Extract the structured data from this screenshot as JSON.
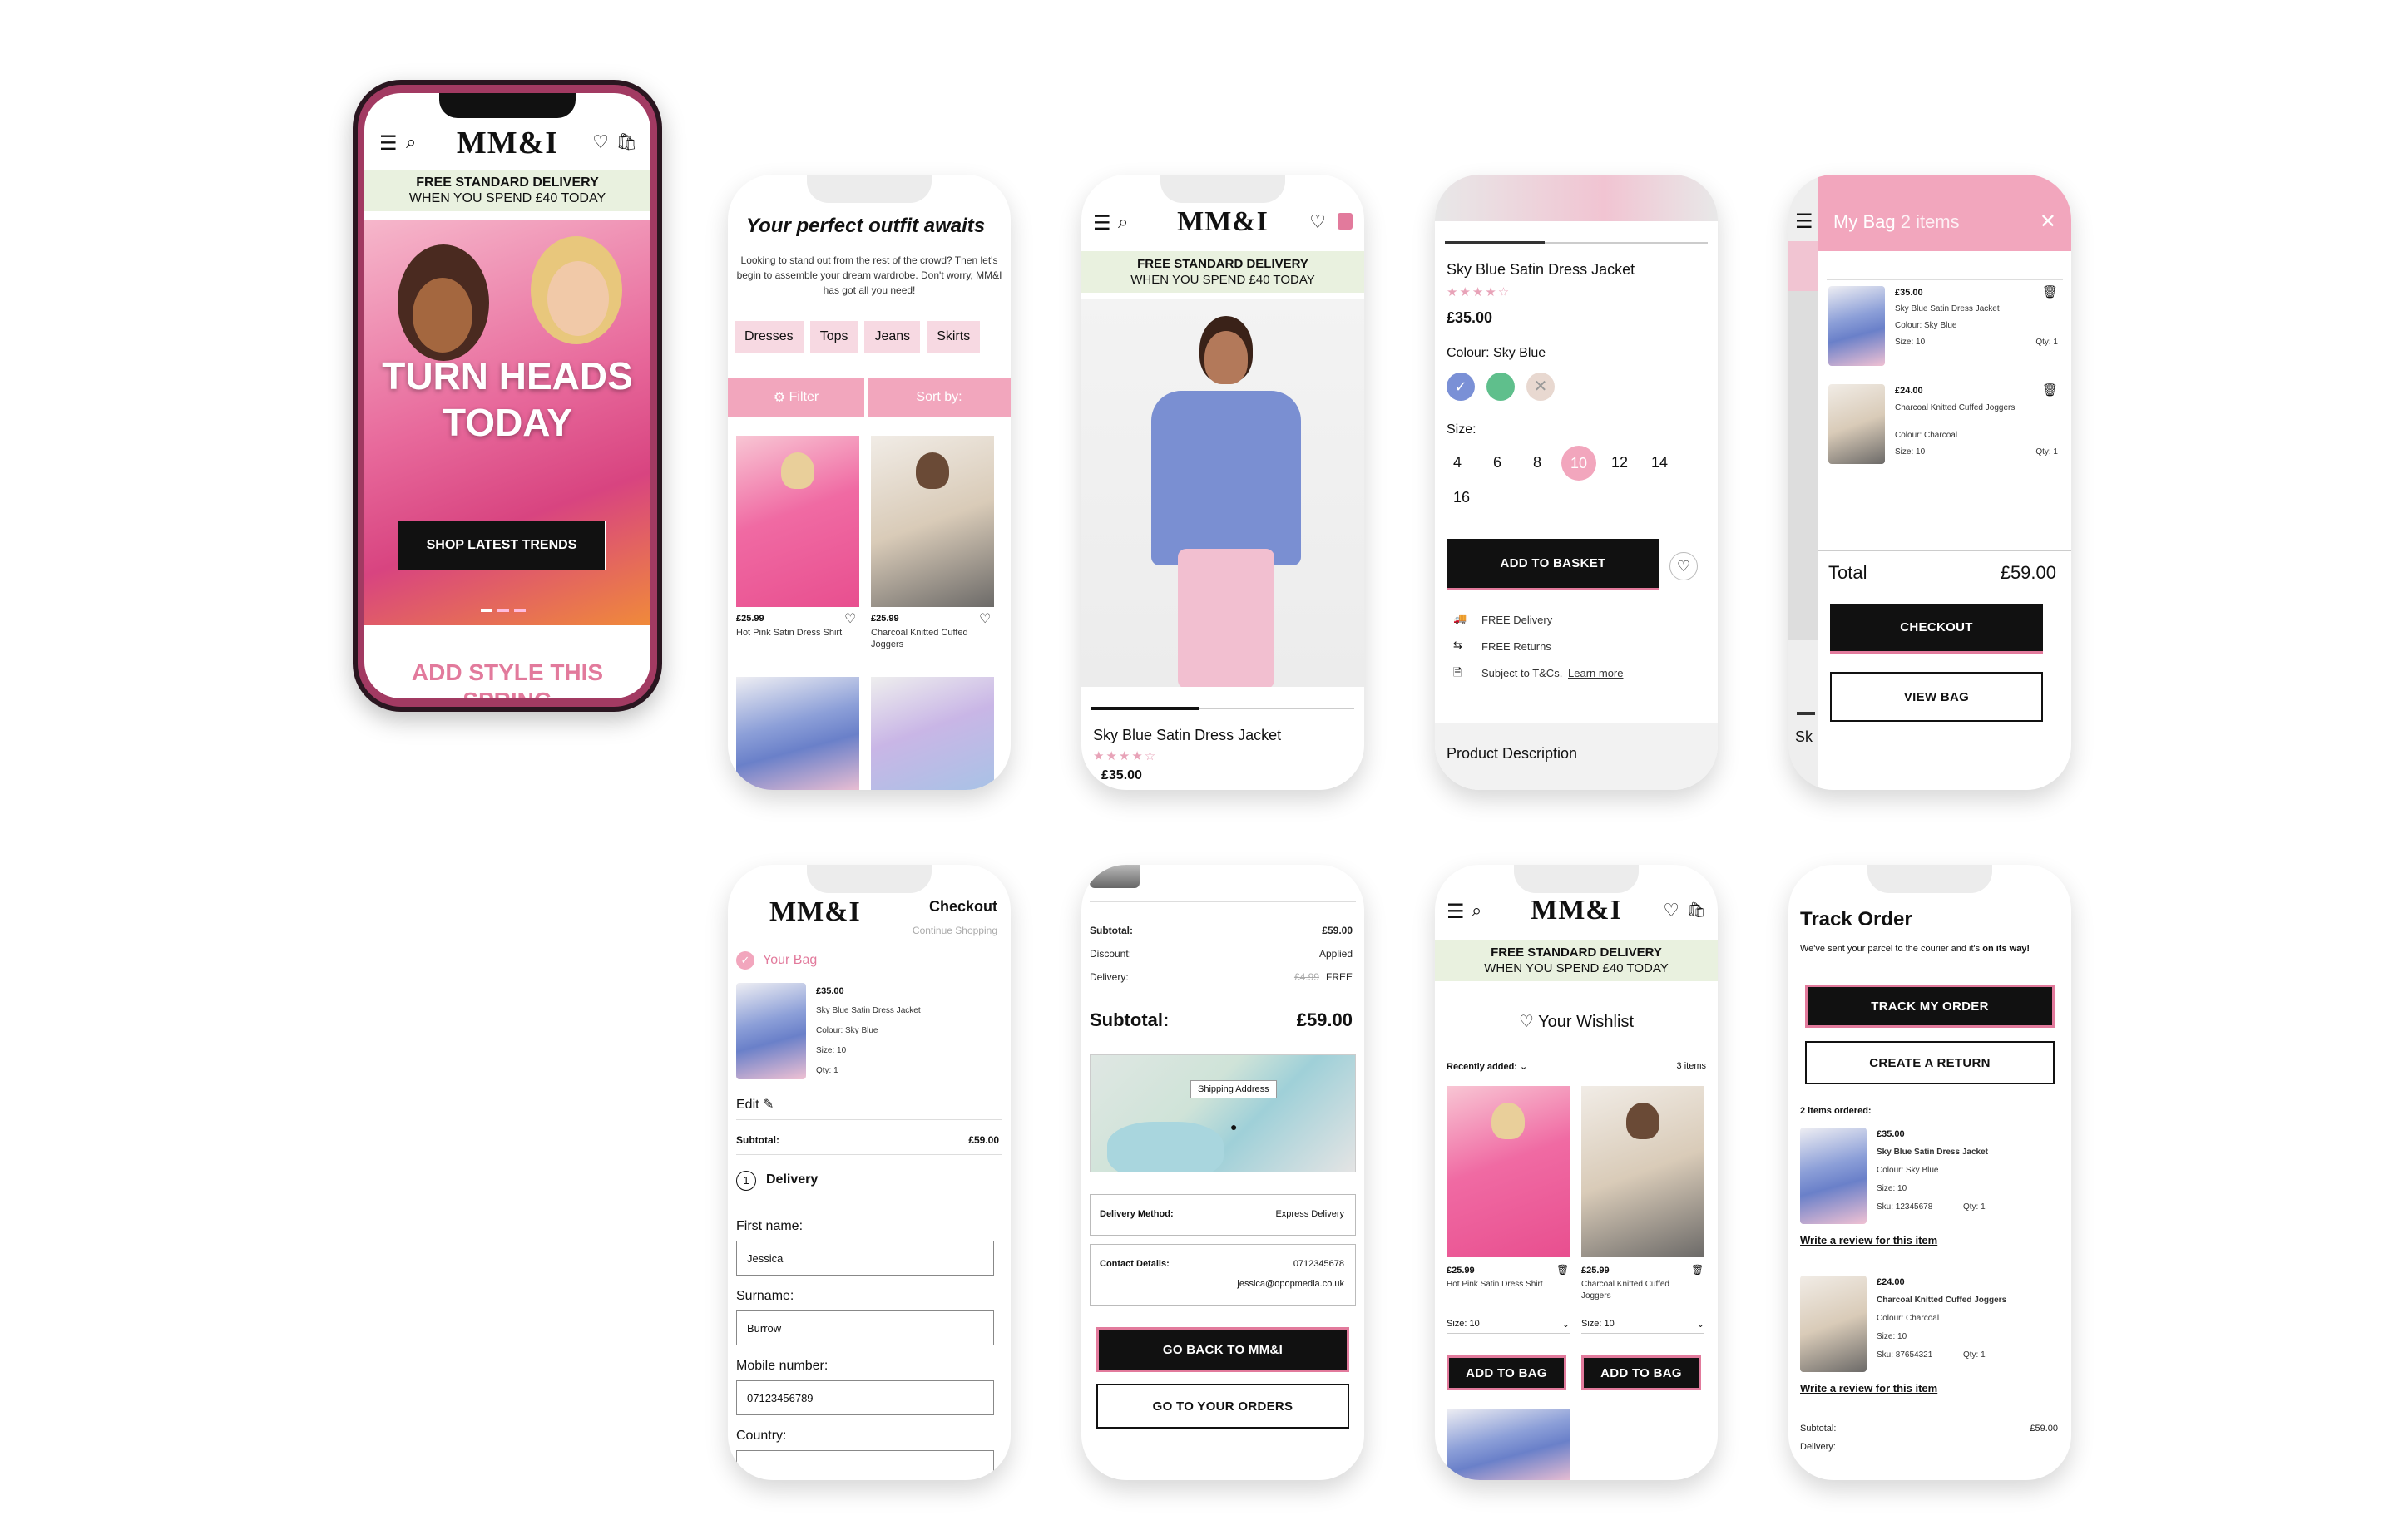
{
  "brand": {
    "logo": "MM&I"
  },
  "home": {
    "delivery_line1": "FREE STANDARD DELIVERY",
    "delivery_line2": "WHEN YOU SPEND £40 TODAY",
    "hero_title": "TURN HEADS TODAY",
    "cta": "SHOP LATEST TRENDS",
    "section_title": "ADD STYLE THIS SPRING"
  },
  "listing": {
    "title": "Your perfect outfit awaits",
    "intro": "Looking to stand out from the rest of the crowd? Then let's begin to assemble your dream wardrobe. Don't worry, MM&I has got all you need!",
    "chips": [
      "Dresses",
      "Tops",
      "Jeans",
      "Skirts"
    ],
    "filter": "Filter",
    "sort": "Sort by:",
    "products": [
      {
        "price": "£25.99",
        "name": "Hot Pink Satin Dress Shirt"
      },
      {
        "price": "£25.99",
        "name": "Charcoal Knitted Cuffed Joggers"
      }
    ]
  },
  "product": {
    "delivery_line1": "FREE STANDARD DELIVERY",
    "delivery_line2": "WHEN YOU SPEND £40 TODAY",
    "name": "Sky Blue Satin Dress Jacket",
    "price_partial": "£35.00"
  },
  "detail": {
    "name": "Sky Blue Satin Dress Jacket",
    "price": "£35.00",
    "colour_label": "Colour: Sky Blue",
    "colours": [
      "#7a90d6",
      "#5fbf8c",
      "#e8d8d0"
    ],
    "size_label": "Size:",
    "sizes": [
      "4",
      "6",
      "8",
      "10",
      "12",
      "14",
      "16"
    ],
    "selected_size": "10",
    "add": "ADD TO BASKET",
    "perks": [
      "FREE Delivery",
      "FREE Returns",
      "Subject to T&Cs."
    ],
    "learn_more": "Learn more",
    "desc": "Product Description",
    "rating": 4
  },
  "bag": {
    "title": "My Bag",
    "count": "2 items",
    "items": [
      {
        "price": "£35.00",
        "name": "Sky Blue Satin Dress Jacket",
        "colour": "Colour: Sky Blue",
        "size": "Size: 10",
        "qty": "Qty: 1"
      },
      {
        "price": "£24.00",
        "name": "Charcoal Knitted Cuffed Joggers",
        "colour": "Colour: Charcoal",
        "size": "Size: 10",
        "qty": "Qty: 1"
      }
    ],
    "total_label": "Total",
    "total": "£59.00",
    "checkout": "CHECKOUT",
    "view": "VIEW BAG",
    "peek": "Sk"
  },
  "checkout": {
    "title": "Checkout",
    "continue": "Continue Shopping",
    "your_bag": "Your Bag",
    "item": {
      "price": "£35.00",
      "name": "Sky Blue Satin Dress Jacket",
      "colour": "Colour: Sky Blue",
      "size": "Size: 10",
      "qty": "Qty: 1"
    },
    "edit": "Edit",
    "subtotal_label": "Subtotal:",
    "subtotal": "£59.00",
    "step": "1",
    "delivery": "Delivery",
    "first_label": "First name:",
    "first": "Jessica",
    "surname_label": "Surname:",
    "surname": "Burrow",
    "mobile_label": "Mobile number:",
    "mobile": "07123456789",
    "country_label": "Country:"
  },
  "confirm": {
    "subtotal_label": "Subtotal:",
    "subtotal": "£59.00",
    "discount_label": "Discount:",
    "discount": "Applied",
    "delivery_label": "Delivery:",
    "delivery_old": "£4.99",
    "delivery": "FREE",
    "big_label": "Subtotal:",
    "big": "£59.00",
    "map_label": "Shipping Address",
    "method_label": "Delivery Method:",
    "method": "Express Delivery",
    "contact_label": "Contact Details:",
    "phone": "0712345678",
    "email": "jessica@opopmedia.co.uk",
    "back": "GO BACK TO MM&I",
    "orders": "GO TO YOUR ORDERS"
  },
  "wishlist": {
    "delivery_line1": "FREE STANDARD DELIVERY",
    "delivery_line2": "WHEN YOU SPEND £40 TODAY",
    "title": "Your Wishlist",
    "recent": "Recently added:",
    "count": "3 items",
    "items": [
      {
        "price": "£25.99",
        "name": "Hot Pink Satin Dress Shirt",
        "size": "Size: 10",
        "add": "ADD TO BAG"
      },
      {
        "price": "£25.99",
        "name": "Charcoal Knitted Cuffed Joggers",
        "size": "Size: 10",
        "add": "ADD TO BAG"
      }
    ]
  },
  "track": {
    "title": "Track Order",
    "msg": "We've sent your parcel to the courier and it's",
    "msg_bold": "on its way!",
    "track": "TRACK MY ORDER",
    "ret": "CREATE A RETURN",
    "ordered": "2 items ordered:",
    "items": [
      {
        "price": "£35.00",
        "name": "Sky Blue Satin Dress Jacket",
        "colour": "Colour: Sky Blue",
        "size": "Size: 10",
        "sku": "Sku: 12345678",
        "qty": "Qty: 1"
      },
      {
        "price": "£24.00",
        "name": "Charcoal Knitted Cuffed Joggers",
        "colour": "Colour: Charcoal",
        "size": "Size: 10",
        "sku": "Sku: 87654321",
        "qty": "Qty: 1"
      }
    ],
    "review": "Write a review for this item",
    "subtotal_label": "Subtotal:",
    "subtotal": "£59.00",
    "delivery_label": "Delivery:"
  },
  "colors": {
    "accent": "#e27a9c",
    "delivery_bg": "#e9f1df",
    "chip_bg": "#f7d9e2",
    "filter_bg": "#f2a6bd"
  }
}
